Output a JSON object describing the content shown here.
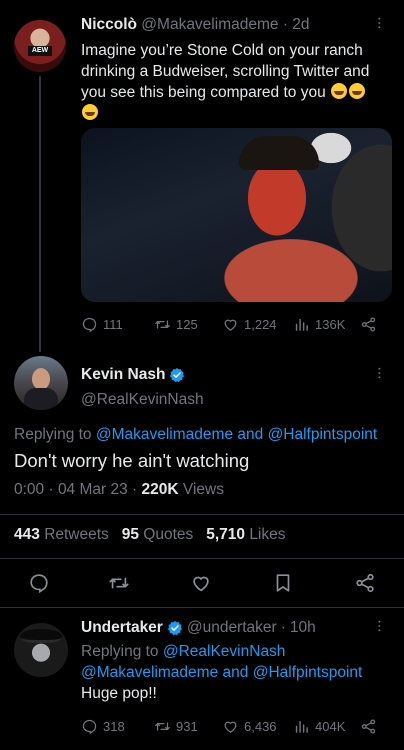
{
  "tweet1": {
    "name": "Niccolò",
    "handle": "@Makavelimademe",
    "time": "2d",
    "text": "Imagine you’re Stone Cold on your ranch drinking a Budweiser, scrolling Twitter and you see this being compared to you",
    "avatar_badge": "AEW",
    "actions": {
      "replies": "111",
      "retweets": "125",
      "likes": "1,224",
      "views": "136K"
    }
  },
  "tweet2": {
    "name": "Kevin Nash",
    "handle": "@RealKevinNash",
    "replying_prefix": "Replying to",
    "replying_user1": "@Makavelimademe",
    "replying_and": "and",
    "replying_user2": "@Halfpintspoint",
    "text": "Don't worry he ain't watching",
    "time": "0:00 · 04 Mar 23 ·",
    "views_count": "220K",
    "views_label": "Views",
    "retweets_count": "443",
    "retweets_label": "Retweets",
    "quotes_count": "95",
    "quotes_label": "Quotes",
    "likes_count": "5,710",
    "likes_label": "Likes"
  },
  "tweet3": {
    "name": "Undertaker",
    "handle": "@undertaker",
    "time": "10h",
    "replying_prefix": "Replying to",
    "replying_user1": "@RealKevinNash",
    "replying_user2": "@Makavelimademe",
    "replying_and": "and",
    "replying_user3": "@Halfpintspoint",
    "text": "Huge pop!!",
    "actions": {
      "replies": "318",
      "retweets": "931",
      "likes": "6,436",
      "views": "404K"
    }
  },
  "colors": {
    "background": "#000000",
    "text": "#e7e9ea",
    "muted": "#71767b",
    "link": "#1d9bf0",
    "divider": "#2f3336"
  },
  "icons": [
    "reply-icon",
    "retweet-icon",
    "like-icon",
    "views-icon",
    "share-icon",
    "bookmark-icon",
    "verified-icon",
    "more-icon"
  ]
}
